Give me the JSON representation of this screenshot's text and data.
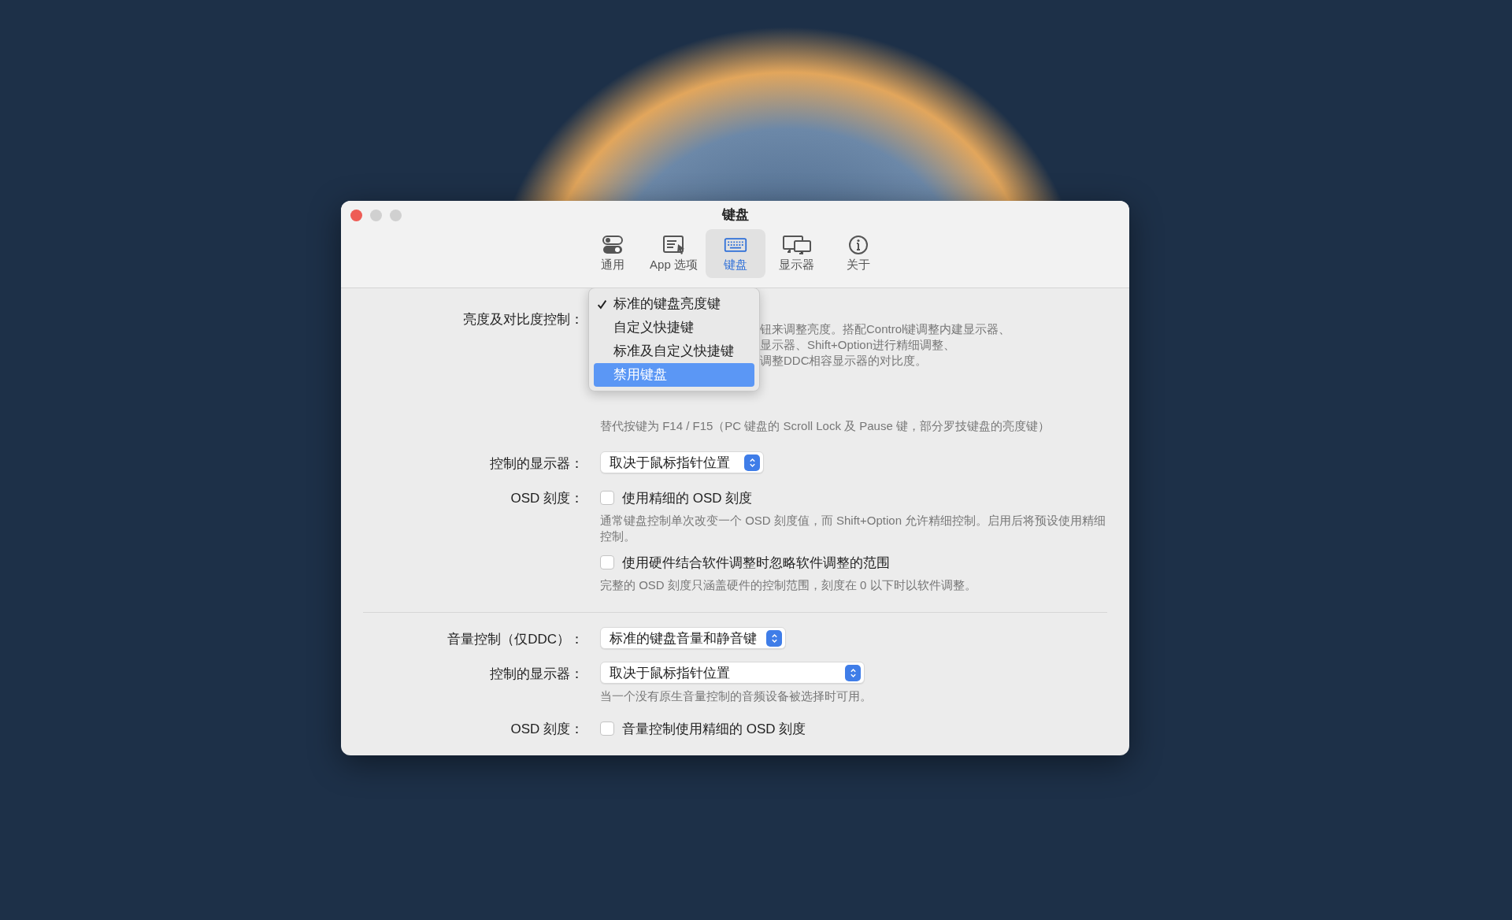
{
  "window": {
    "title": "键盘"
  },
  "tabs": [
    {
      "label": "通用",
      "selected": false
    },
    {
      "label": "App 选项",
      "selected": false
    },
    {
      "label": "键盘",
      "selected": true
    },
    {
      "label": "显示器",
      "selected": false
    },
    {
      "label": "关于",
      "selected": false
    }
  ],
  "brightness": {
    "label": "亮度及对比度控制：",
    "menu": [
      {
        "label": "标准的键盘亮度键",
        "checked": true,
        "selected": false
      },
      {
        "label": "自定义快捷键",
        "checked": false,
        "selected": false
      },
      {
        "label": "标准及自定义快捷键",
        "checked": false,
        "selected": false
      },
      {
        "label": "禁用键盘",
        "checked": false,
        "selected": true
      }
    ],
    "description_lines": [
      "钮来调整亮度。搭配Control键调整内建显示器、",
      "显示器、Shift+Option进行精细调整、",
      "调整DDC相容显示器的对比度。"
    ],
    "note": "替代按键为 F14 / F15（PC 键盘的 Scroll Lock 及 Pause 键，部分罗技键盘的亮度键）"
  },
  "brightness_display": {
    "label": "控制的显示器：",
    "value": "取决于鼠标指针位置"
  },
  "brightness_osd": {
    "label": "OSD 刻度：",
    "options": [
      {
        "label": "使用精细的 OSD 刻度",
        "checked": false,
        "description": "通常键盘控制单次改变一个 OSD 刻度值，而 Shift+Option 允许精细控制。启用后将预设使用精细控制。"
      },
      {
        "label": "使用硬件结合软件调整时忽略软件调整的范围",
        "checked": false,
        "description": "完整的 OSD 刻度只涵盖硬件的控制范围，刻度在 0 以下时以软件调整。"
      }
    ]
  },
  "volume": {
    "label": "音量控制（仅DDC）：",
    "value": "标准的键盘音量和静音键"
  },
  "volume_display": {
    "label": "控制的显示器：",
    "value": "取决于鼠标指针位置",
    "description": "当一个没有原生音量控制的音频设备被选择时可用。"
  },
  "volume_osd": {
    "label": "OSD 刻度：",
    "option": {
      "label": "音量控制使用精细的 OSD 刻度",
      "checked": false
    }
  }
}
